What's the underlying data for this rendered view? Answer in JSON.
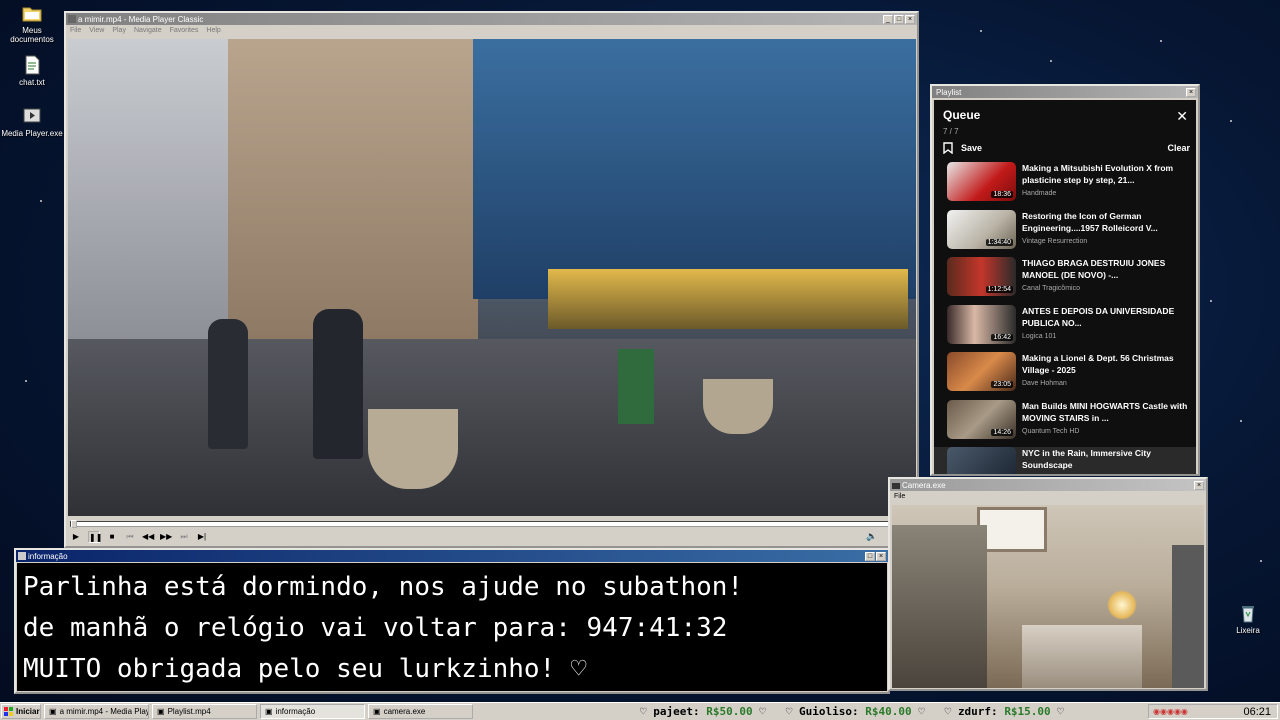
{
  "desktop": {
    "icons": [
      {
        "label": "Meus documentos",
        "icon": "folder-icon"
      },
      {
        "label": "chat.txt",
        "icon": "text-file-icon"
      },
      {
        "label": "Media Player.exe",
        "icon": "media-player-icon"
      },
      {
        "label": "Lixeira",
        "icon": "recycle-bin-icon"
      }
    ]
  },
  "player": {
    "title": "a mimir.mp4 - Media Player Classic",
    "menu": [
      "File",
      "View",
      "Play",
      "Navigate",
      "Favorites",
      "Help"
    ],
    "progress": 0.0
  },
  "playlist": {
    "window_title": "Playlist",
    "header": "Queue",
    "count": "7 / 7",
    "save_label": "Save",
    "clear_label": "Clear",
    "items": [
      {
        "title": "Making a Mitsubishi Evolution X from plasticine step by step, 21...",
        "channel": "Handmade",
        "duration": "18:36"
      },
      {
        "title": "Restoring the Icon of German Engineering....1957 Rolleicord V...",
        "channel": "Vintage Resurrection",
        "duration": "1:34:40"
      },
      {
        "title": "THIAGO BRAGA DESTRUIU JONES MANOEL (DE NOVO) -...",
        "channel": "Canal Tragicômico",
        "duration": "1:12:54"
      },
      {
        "title": "ANTES E DEPOIS DA UNIVERSIDADE PUBLICA NO...",
        "channel": "Logica 101",
        "duration": "16:42"
      },
      {
        "title": "Making a Lionel & Dept. 56 Christmas Village - 2025",
        "channel": "Dave Hohman",
        "duration": "23:05"
      },
      {
        "title": "Man Builds MINI HOGWARTS Castle with MOVING STAIRS in ...",
        "channel": "Quantum Tech HD",
        "duration": "14:26"
      },
      {
        "title": "NYC in the Rain, Immersive City Soundscape",
        "channel": "",
        "duration": ""
      }
    ]
  },
  "info": {
    "title": "informação",
    "lines": [
      "Parlinha está dormindo, nos ajude no subathon!",
      "de manhã o relógio vai voltar para:  947:41:32",
      "MUITO obrigada pelo seu lurkzinho! ♡"
    ]
  },
  "camera": {
    "title": "Camera.exe",
    "menu": "File"
  },
  "taskbar": {
    "start_label": "Iniciar",
    "tasks": [
      {
        "label": "a mimir.mp4 - Media Playe..."
      },
      {
        "label": "Playlist.mp4"
      },
      {
        "label": "informação"
      },
      {
        "label": "camera.exe"
      }
    ],
    "ticker": [
      {
        "name": "pajeet:",
        "amount": "R$50.00"
      },
      {
        "name": "Guioliso:",
        "amount": "R$40.00"
      },
      {
        "name": "zdurf:",
        "amount": "R$15.00"
      }
    ],
    "clock": "06:21"
  }
}
